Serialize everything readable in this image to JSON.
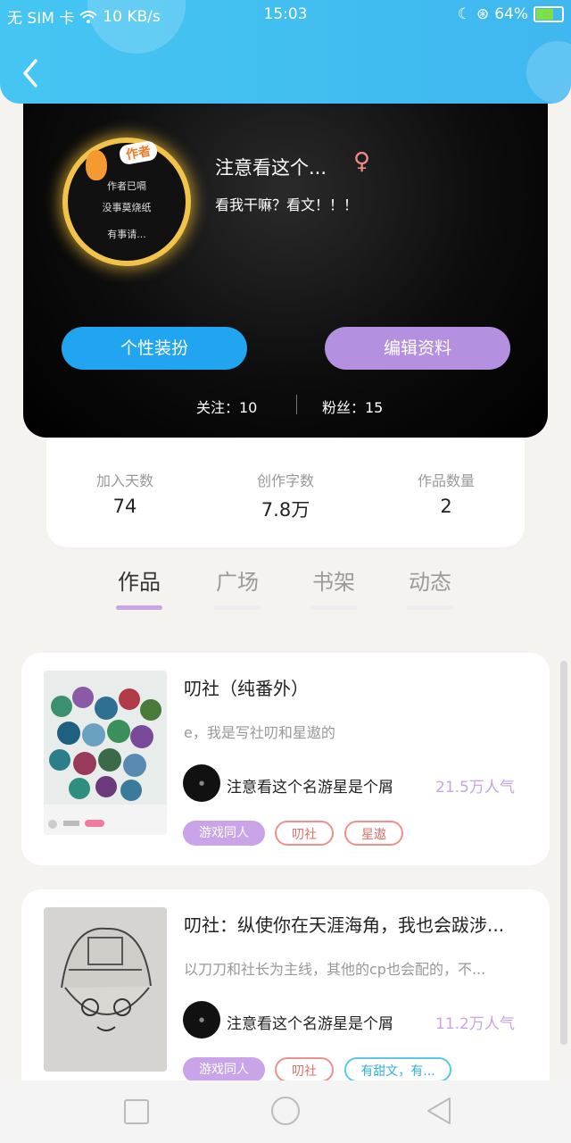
{
  "status_bar": {
    "carrier": "无 SIM 卡",
    "speed": "10 KB/s",
    "time": "15:03",
    "battery": "64%"
  },
  "header": {
    "back_icon": "back-arrow-icon"
  },
  "profile": {
    "avatar_badge": "作者",
    "avatar_lines": [
      "作者已嗝",
      "没事莫烧纸",
      "有事请..."
    ],
    "username": "注意看这个...",
    "gender_symbol": "♀",
    "bio": "看我干嘛？看文！！！",
    "buttons": {
      "dress_up": "个性装扮",
      "edit_profile": "编辑资料"
    },
    "follow": "关注：10",
    "fans": "粉丝：15"
  },
  "stats": [
    {
      "label": "加入天数",
      "value": "74"
    },
    {
      "label": "创作字数",
      "value": "7.8万"
    },
    {
      "label": "作品数量",
      "value": "2"
    }
  ],
  "tabs": [
    {
      "label": "作品",
      "active": true
    },
    {
      "label": "广场",
      "active": false
    },
    {
      "label": "书架",
      "active": false
    },
    {
      "label": "动态",
      "active": false
    }
  ],
  "works": [
    {
      "title": "叨社（纯番外）",
      "description": "e，我是写社叨和星遨的",
      "author": "注意看这个名游星是个屑",
      "popularity": "21.5万人气",
      "tags": [
        "游戏同人",
        "叨社",
        "星遨"
      ]
    },
    {
      "title": "叨社：纵使你在天涯海角，我也会跋涉...",
      "description": "以刀刀和社长为主线，其他的cp也会配的，不...",
      "author": "注意看这个名游星是个屑",
      "popularity": "11.2万人气",
      "tags": [
        "游戏同人",
        "叨社",
        "有甜文，有..."
      ]
    }
  ],
  "colors": {
    "header": "#45c6f2",
    "accent_purple": "#c9a4e8",
    "button_blue": "#22a5f0"
  }
}
